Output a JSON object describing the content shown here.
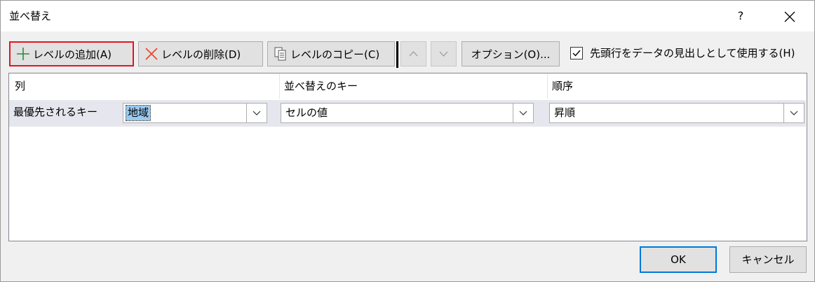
{
  "dialog": {
    "title": "並べ替え",
    "help_label": "?"
  },
  "toolbar": {
    "add_level_label": "レベルの追加(A)",
    "delete_level_label": "レベルの削除(D)",
    "copy_level_label": "レベルのコピー(C)",
    "options_label": "オプション(O)...",
    "header_checkbox_label": "先頭行をデータの見出しとして使用する(H)",
    "header_checkbox_checked": true
  },
  "grid": {
    "headers": {
      "column": "列",
      "sort_on": "並べ替えのキー",
      "order": "順序"
    },
    "rows": [
      {
        "label": "最優先されるキー",
        "column_value": "地域",
        "sort_on_value": "セルの値",
        "order_value": "昇順"
      }
    ]
  },
  "footer": {
    "ok_label": "OK",
    "cancel_label": "キャンセル"
  },
  "colors": {
    "focus_border": "#e81123",
    "default_button_border": "#0078d7",
    "selection": "#99c9ef",
    "add_icon": "#2e8b3a",
    "delete_icon": "#e8452c"
  }
}
